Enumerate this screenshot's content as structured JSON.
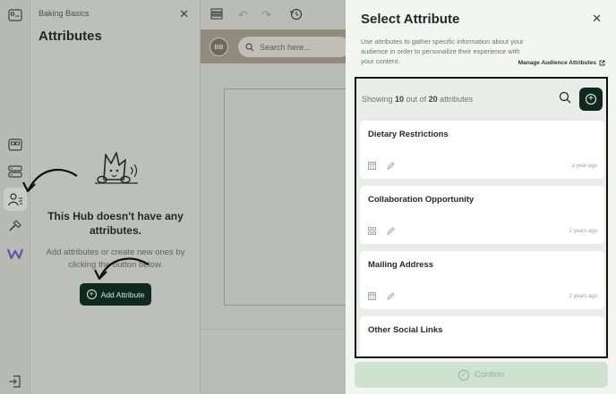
{
  "panel": {
    "breadcrumb": "Baking Basics",
    "title": "Attributes",
    "empty_title": "This Hub doesn't have any attributes.",
    "empty_text": "Add attributes or create new ones by clicking the button below.",
    "add_button_label": "Add Attribute"
  },
  "editor": {
    "avatar_initials": "BB",
    "search_placeholder": "Search here..."
  },
  "modal": {
    "title": "Select Attribute",
    "description": "Use attributes to gather specific information about your audience in order to personalize their experience with your content.",
    "manage_link": "Manage Audience Attributes",
    "showing_prefix": "Showing",
    "showing_count": "10",
    "showing_middle": "out of",
    "showing_total": "20",
    "showing_suffix": "attributes",
    "confirm_label": "Confirm",
    "items": [
      {
        "name": "Dietary Restrictions",
        "time": "a year ago",
        "type_icon": "table-icon"
      },
      {
        "name": "Collaboration Opportunity",
        "time": "2 years ago",
        "type_icon": "grid-icon"
      },
      {
        "name": "Mailing Address",
        "time": "2 years ago",
        "type_icon": "table-icon"
      },
      {
        "name": "Other Social Links",
        "time": "",
        "type_icon": "table-icon"
      }
    ]
  },
  "colors": {
    "accent_dark": "#0f2820",
    "modal_bg": "#f2f5f1",
    "overlay": "#b9bcb7",
    "confirm_disabled": "#cfe1d1",
    "brand_w": "#6b4fa6"
  },
  "rail_icons": [
    "layout-icon",
    "cards-icon",
    "server-icon",
    "audience-icon",
    "hammer-icon",
    "w-logo-icon",
    "exit-icon"
  ]
}
